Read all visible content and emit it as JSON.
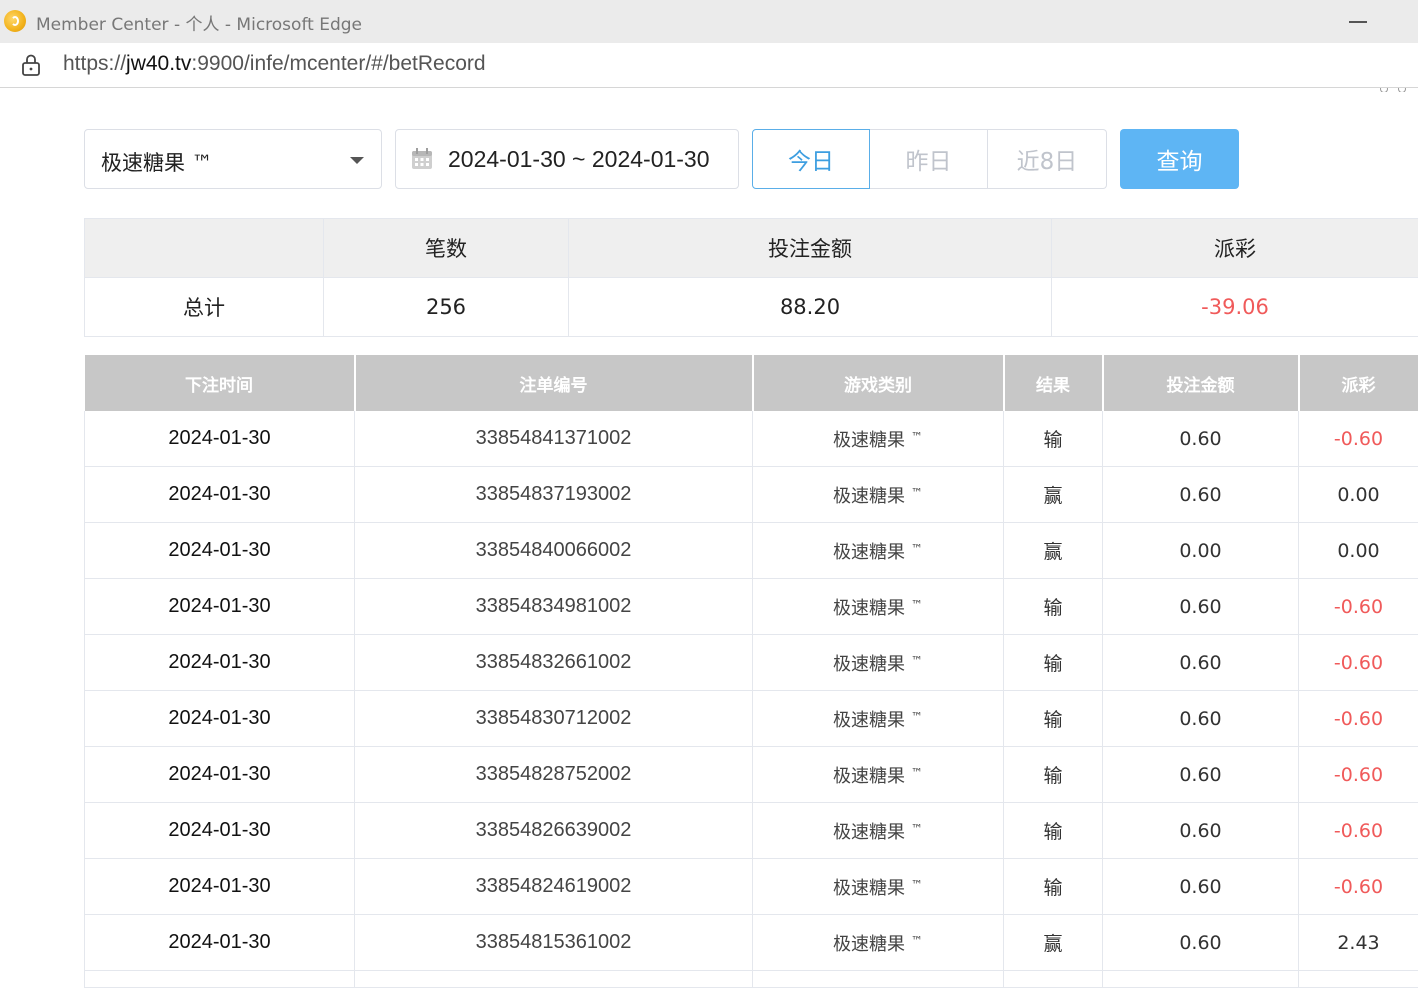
{
  "browser": {
    "window_title": "Member Center - 个人 - Microsoft Edge",
    "url_scheme": "https://",
    "url_host": "jw40.tv",
    "url_rest": ":9900/infe/mcenter/#/betRecord"
  },
  "filters": {
    "game": "极速糖果 ™",
    "date_range": "2024-01-30 ~ 2024-01-30",
    "quick_ranges": [
      "今日",
      "昨日",
      "近8日"
    ],
    "active_quick_range": "今日",
    "query_label": "查询"
  },
  "summary": {
    "headers": [
      "",
      "笔数",
      "投注金额",
      "派彩"
    ],
    "row_label": "总计",
    "count": "256",
    "bet_amount": "88.20",
    "payout": "-39.06"
  },
  "records": {
    "headers": [
      "下注时间",
      "注单编号",
      "游戏类别",
      "结果",
      "投注金额",
      "派彩"
    ],
    "rows": [
      {
        "time": "2024-01-30",
        "id": "33854841371002",
        "game": "极速糖果",
        "result": "输",
        "bet": "0.60",
        "payout": "-0.60"
      },
      {
        "time": "2024-01-30",
        "id": "33854837193002",
        "game": "极速糖果",
        "result": "赢",
        "bet": "0.60",
        "payout": "0.00"
      },
      {
        "time": "2024-01-30",
        "id": "33854840066002",
        "game": "极速糖果",
        "result": "赢",
        "bet": "0.00",
        "payout": "0.00"
      },
      {
        "time": "2024-01-30",
        "id": "33854834981002",
        "game": "极速糖果",
        "result": "输",
        "bet": "0.60",
        "payout": "-0.60"
      },
      {
        "time": "2024-01-30",
        "id": "33854832661002",
        "game": "极速糖果",
        "result": "输",
        "bet": "0.60",
        "payout": "-0.60"
      },
      {
        "time": "2024-01-30",
        "id": "33854830712002",
        "game": "极速糖果",
        "result": "输",
        "bet": "0.60",
        "payout": "-0.60"
      },
      {
        "time": "2024-01-30",
        "id": "33854828752002",
        "game": "极速糖果",
        "result": "输",
        "bet": "0.60",
        "payout": "-0.60"
      },
      {
        "time": "2024-01-30",
        "id": "33854826639002",
        "game": "极速糖果",
        "result": "输",
        "bet": "0.60",
        "payout": "-0.60"
      },
      {
        "time": "2024-01-30",
        "id": "33854824619002",
        "game": "极速糖果",
        "result": "输",
        "bet": "0.60",
        "payout": "-0.60"
      },
      {
        "time": "2024-01-30",
        "id": "33854815361002",
        "game": "极速糖果",
        "result": "赢",
        "bet": "0.60",
        "payout": "2.43"
      }
    ],
    "game_suffix": "™"
  },
  "colors": {
    "negative": "#f05a5a",
    "accent": "#3d9ee0",
    "query_button": "#5eb5f4",
    "table_header": "#c7c7c7"
  }
}
